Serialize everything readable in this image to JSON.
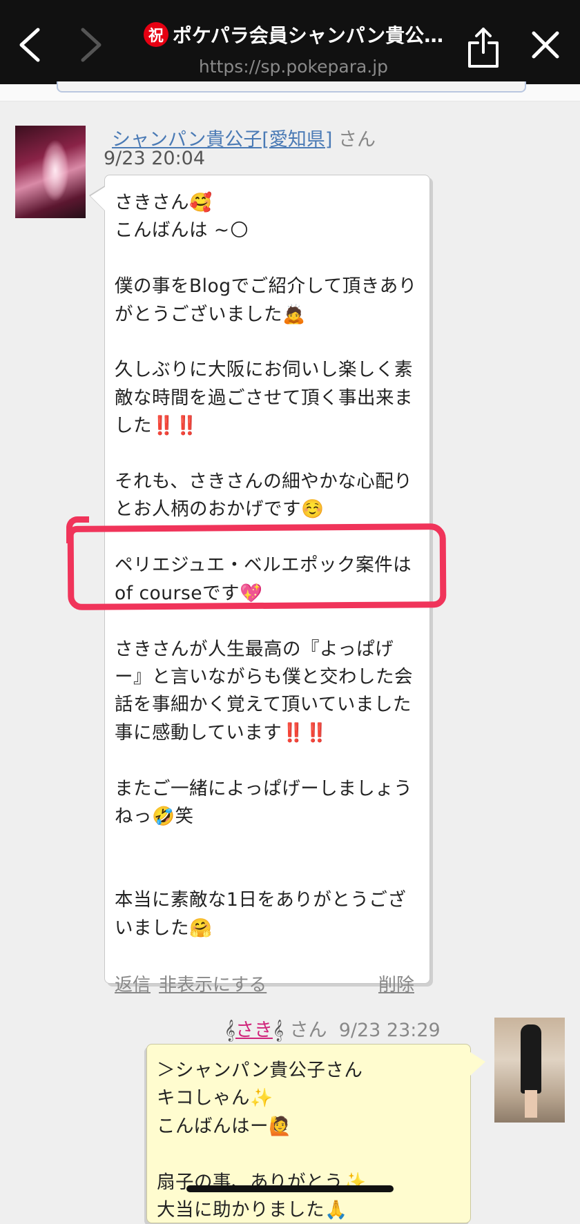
{
  "browser": {
    "title": "ポケパラ会員シャンパン貴公…",
    "title_badge": "祝",
    "url": "https://sp.pokepara.jp"
  },
  "message1": {
    "sender_name": "シャンパン貴公子[愛知県]",
    "sender_suffix": "さん",
    "time": "9/23 20:04",
    "text_part1": "さきさん🥰\nこんばんは ~🌕\n\n僕の事をBlogでご紹介して頂きありがとうございました🙇\n\n久しぶりに大阪にお伺いし楽しく素敵な時間を過ごさせて頂く事出来ました‼️‼️\n\nそれも、さきさんの細やかな心配りとお人柄のおかげです☺️\n\nペリエジュエ・ベルエポック案件はof courseです💖\n\nさきさんが人生最高の『よっぱげー』と言いながらも僕と交わした会話を事細かく覚えて頂いていました事に感動しています‼️‼️\n\nまたご一緒によっぱげーしましょうねっ🤣笑\n\n\n本当に素敵な1日をありがとうございました🤗",
    "actions": {
      "reply": "返信",
      "hide": "非表示にする",
      "delete": "削除"
    }
  },
  "message2": {
    "sender_prefix": "𝄞",
    "sender_name": "さき",
    "sender_suffix_clef": "𝄞",
    "sender_suffix": "さん",
    "time": "9/23 23:29",
    "text": "＞シャンパン貴公子さん\nキコしゃん✨\nこんばんはー🙋\n\n扇子の事、ありがとう✨\n大当に助かりました🙏"
  }
}
